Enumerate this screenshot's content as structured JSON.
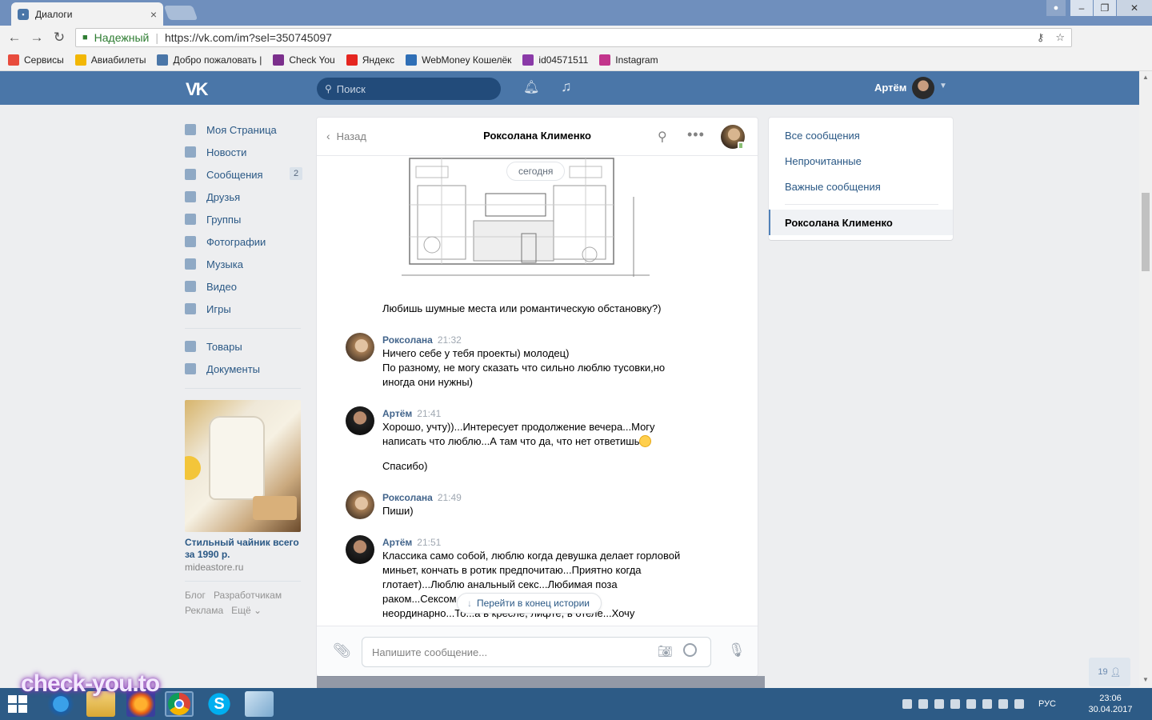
{
  "browser": {
    "tab_title": "Диалоги",
    "tab_close": "×",
    "secure_label": "Надежный",
    "url": "https://vk.com/im?sel=350745097",
    "bookmarks": [
      {
        "label": "Сервисы",
        "color": "#e84c3d"
      },
      {
        "label": "Авиабилеты",
        "color": "#f2b705"
      },
      {
        "label": "Добро пожаловать |",
        "color": "#4a76a8"
      },
      {
        "label": "Check You",
        "color": "#7b2f8c"
      },
      {
        "label": "Яндекс",
        "color": "#e52620"
      },
      {
        "label": "WebMoney Кошелёк",
        "color": "#2f6fb6"
      },
      {
        "label": "id04571511",
        "color": "#8a3aa8"
      },
      {
        "label": "Instagram",
        "color": "#c2358c"
      }
    ]
  },
  "vk": {
    "search_placeholder": "Поиск",
    "user_name": "Артём",
    "menu": [
      {
        "label": "Моя Страница",
        "badge": ""
      },
      {
        "label": "Новости",
        "badge": ""
      },
      {
        "label": "Сообщения",
        "badge": "2"
      },
      {
        "label": "Друзья",
        "badge": ""
      },
      {
        "label": "Группы",
        "badge": ""
      },
      {
        "label": "Фотографии",
        "badge": ""
      },
      {
        "label": "Музыка",
        "badge": ""
      },
      {
        "label": "Видео",
        "badge": ""
      },
      {
        "label": "Игры",
        "badge": ""
      }
    ],
    "menu2": [
      {
        "label": "Товары"
      },
      {
        "label": "Документы"
      }
    ],
    "ad": {
      "title": "Стильный чайник всего за 1990 р.",
      "domain": "mideastore.ru"
    },
    "footer": {
      "line1": [
        "Блог",
        "Разработчикам"
      ],
      "line2": [
        "Реклама",
        "Ещё ⌄"
      ]
    },
    "friends_count": "19"
  },
  "chat": {
    "back_label": "Назад",
    "peer_name": "Роксолана Клименко",
    "date_divider": "сегодня",
    "messages": [
      {
        "author": "",
        "time": "",
        "lines": [
          "Любишь шумные места или романтическую обстановку?)"
        ]
      },
      {
        "author": "Роксолана",
        "time": "21:32",
        "lines": [
          "Ничего себе у тебя проекты) молодец)",
          "По разному, не могу сказать что сильно люблю тусовки,но иногда они нужны)"
        ]
      },
      {
        "author": "Артём",
        "time": "21:41",
        "lines": [
          "Хорошо, учту))...Интересует продолжение вечера...Могу написать что люблю...А там что да, что нет ответишь",
          "Спасибо)"
        ]
      },
      {
        "author": "Роксолана",
        "time": "21:49",
        "lines": [
          "Пиши)"
        ]
      },
      {
        "author": "Артём",
        "time": "21:51",
        "lines": [
          "Классика само собой, люблю когда девушка делает горловой миньет, кончать в ротик предпочитаю...Приятно когда глотает)...Люблю анальный секс...Любимая поза раком...Сексом",
          "неординарно...То...а в кресле, лифте, в отеле...Хочу"
        ]
      }
    ],
    "jump_label": "Перейти в конец истории",
    "composer_placeholder": "Напишите сообщение..."
  },
  "filters": {
    "items": [
      "Все сообщения",
      "Непрочитанные",
      "Важные сообщения"
    ],
    "active": "Роксолана Клименко"
  },
  "taskbar": {
    "lang": "РУС",
    "time": "23:06",
    "date": "30.04.2017"
  },
  "watermark": "check-you.to"
}
